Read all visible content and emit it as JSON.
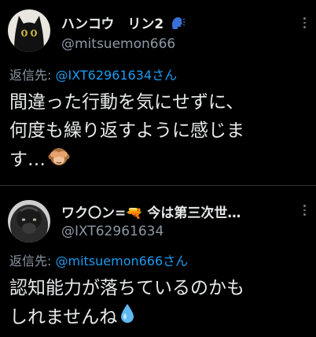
{
  "tweets": [
    {
      "display_name": "ハンコウ　リン2",
      "handle": "@mitsuemon666",
      "reply_prefix": "返信先: ",
      "reply_to": "@IXT62961634さん",
      "text_lines": [
        "間違った行動を気にせずに、",
        "何度も繰り返すように感じま",
        "す…"
      ],
      "emoji": "see-no-evil-monkey",
      "name_emoji": "speaking-head"
    },
    {
      "display_name": "ワク〇ン=🔫 今は第三次世…",
      "handle": "@IXT62961634",
      "reply_prefix": "返信先: ",
      "reply_to": "@mitsuemon666さん",
      "text_lines": [
        "認知能力が落ちているのかも",
        "しれませんね"
      ],
      "emoji": "droplet"
    }
  ],
  "colors": {
    "background": "#000000",
    "text": "#e7e9ea",
    "secondary": "#8b98a5",
    "mention": "#1d9bf0",
    "divider": "#2f3336"
  }
}
